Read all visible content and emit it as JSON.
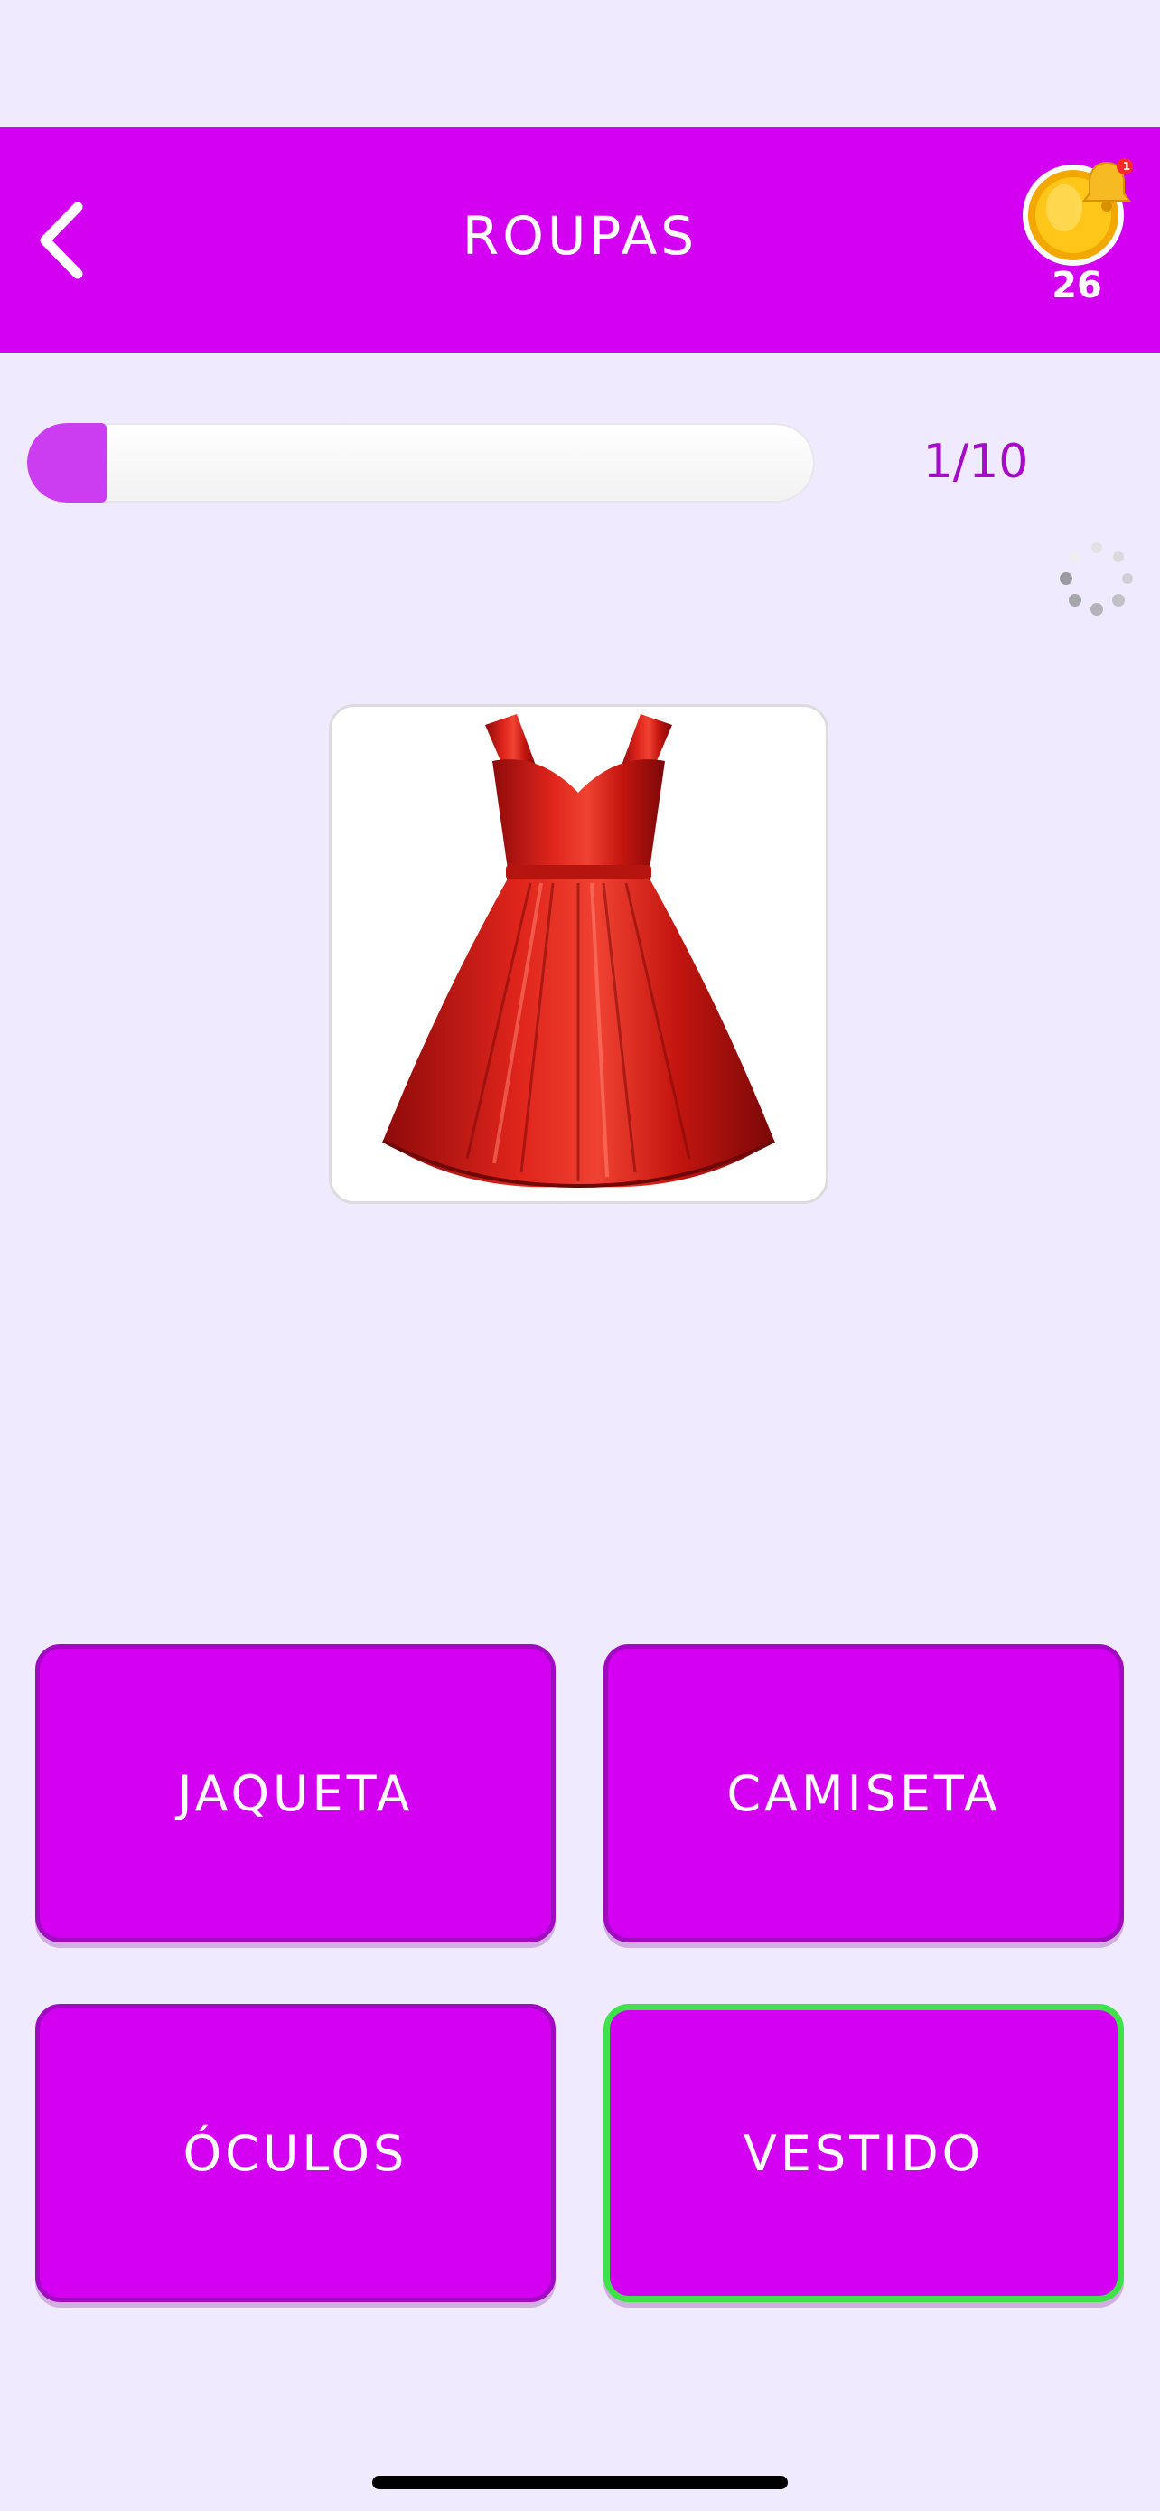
{
  "header": {
    "title": "ROUPAS",
    "coins": "26",
    "bell_badge": "1",
    "color": "#d300f2"
  },
  "progress": {
    "label": "1/10",
    "current": 1,
    "total": 10,
    "fraction": 0.1
  },
  "question": {
    "image": "red-dress"
  },
  "answers": [
    {
      "label": "JAQUETA",
      "selected": false
    },
    {
      "label": "CAMISETA",
      "selected": false
    },
    {
      "label": "ÓCULOS",
      "selected": false
    },
    {
      "label": "VESTIDO",
      "selected": true
    }
  ],
  "colors": {
    "background": "#efeafd",
    "accent": "#d300f2",
    "progress_fill": "#cc3cf0",
    "progress_text": "#a60bc7",
    "selected_border": "#3fe24a"
  }
}
